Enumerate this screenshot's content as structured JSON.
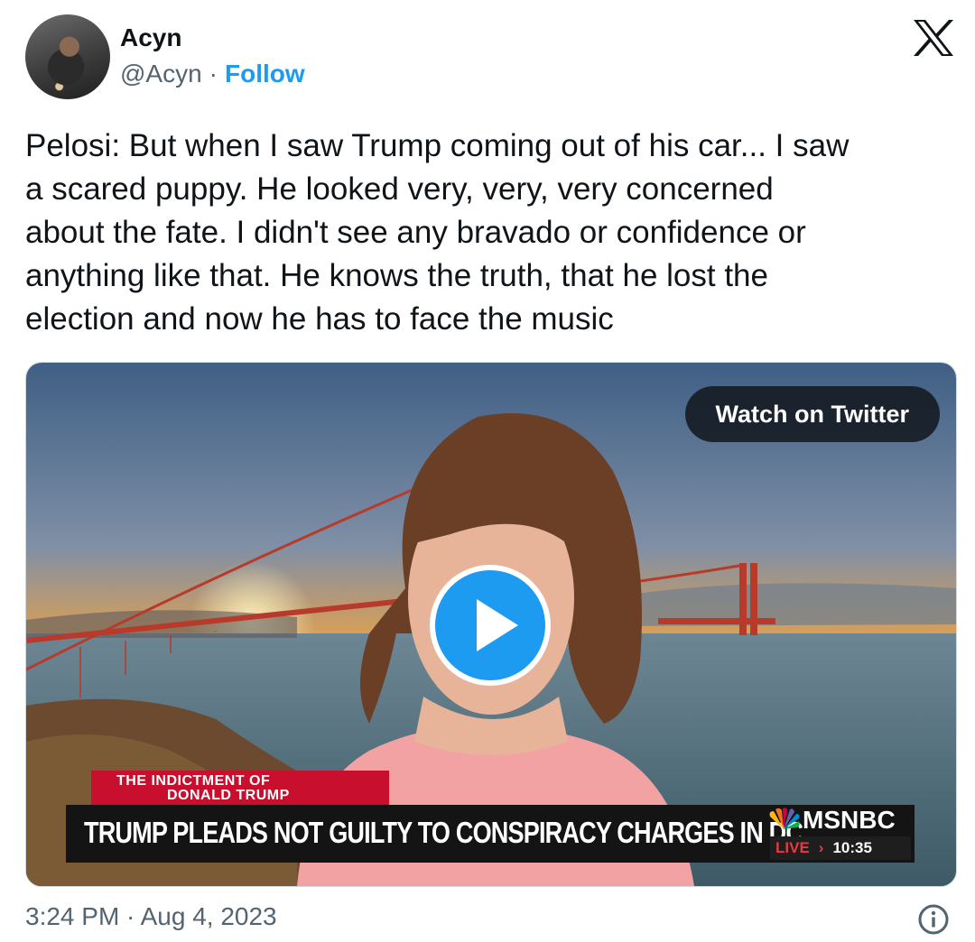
{
  "author": {
    "name": "Acyn",
    "handle": "@Acyn",
    "separator": "·",
    "follow_label": "Follow"
  },
  "tweet": {
    "text": "Pelosi: But when I saw Trump coming out of his car...  I saw\na scared puppy. He looked very, very, very concerned\nabout the fate. I didn't see any bravado or confidence or\nanything like that. He knows the truth, that he lost the\nelection and now he has to face the music"
  },
  "media": {
    "watch_label": "Watch on Twitter",
    "chyron_tag_line1": "THE INDICTMENT OF",
    "chyron_tag_line2": "DONALD TRUMP",
    "chyron_headline": "TRUMP PLEADS NOT GUILTY TO CONSPIRACY CHARGES IN DC",
    "network": "MSNBC",
    "live_label": "LIVE",
    "live_arrow": "›",
    "live_time": "10:35",
    "play_icon": "play-icon"
  },
  "footer": {
    "timestamp": "3:24 PM · Aug 4, 2023"
  },
  "colors": {
    "accent": "#1d9bf0",
    "text": "#0f1419",
    "muted": "#536471",
    "chyron_red": "#c8102e"
  }
}
